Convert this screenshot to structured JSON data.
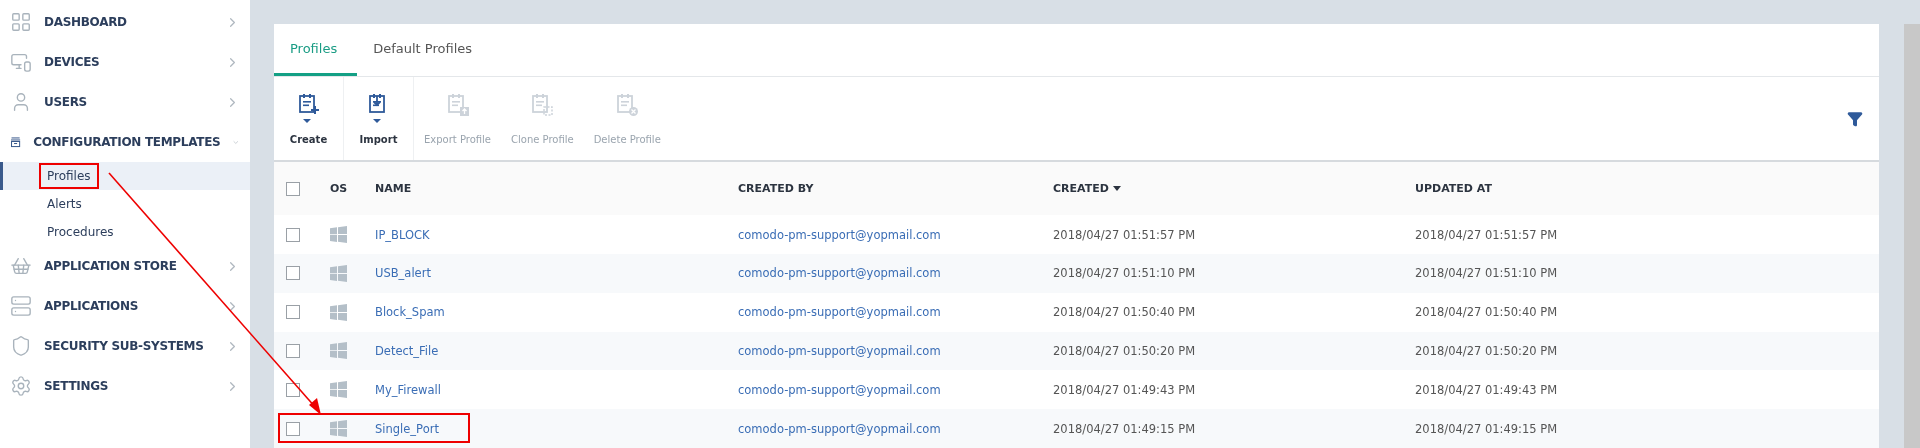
{
  "sidebar": {
    "items": [
      {
        "label": "DASHBOARD",
        "expanded": false
      },
      {
        "label": "DEVICES",
        "expanded": false
      },
      {
        "label": "USERS",
        "expanded": false
      },
      {
        "label": "CONFIGURATION TEMPLATES",
        "expanded": true,
        "children": [
          {
            "label": "Profiles",
            "selected": true,
            "highlighted": true
          },
          {
            "label": "Alerts",
            "selected": false,
            "highlighted": false
          },
          {
            "label": "Procedures",
            "selected": false,
            "highlighted": false
          }
        ]
      },
      {
        "label": "APPLICATION STORE",
        "expanded": false
      },
      {
        "label": "APPLICATIONS",
        "expanded": false
      },
      {
        "label": "SECURITY SUB-SYSTEMS",
        "expanded": false
      },
      {
        "label": "SETTINGS",
        "expanded": false
      }
    ]
  },
  "tabs": [
    {
      "label": "Profiles",
      "selected": true
    },
    {
      "label": "Default Profiles",
      "selected": false
    }
  ],
  "toolbar": [
    {
      "label": "Create",
      "disabled": false
    },
    {
      "label": "Import",
      "disabled": false
    },
    {
      "label": "Export Profile",
      "disabled": true
    },
    {
      "label": "Clone Profile",
      "disabled": true
    },
    {
      "label": "Delete Profile",
      "disabled": true
    }
  ],
  "table": {
    "all_checked": false,
    "columns": [
      {
        "label": "OS",
        "sorted": false
      },
      {
        "label": "NAME",
        "sorted": false
      },
      {
        "label": "CREATED BY",
        "sorted": false
      },
      {
        "label": "CREATED",
        "sorted": true
      },
      {
        "label": "UPDATED AT",
        "sorted": false
      }
    ],
    "rows": [
      {
        "name": "IP_BLOCK",
        "created_by": "comodo-pm-support@yopmail.com",
        "created": "2018/04/27 01:51:57 PM",
        "updated_at": "2018/04/27 01:51:57 PM",
        "checked": false,
        "highlighted": false
      },
      {
        "name": "USB_alert",
        "created_by": "comodo-pm-support@yopmail.com",
        "created": "2018/04/27 01:51:10 PM",
        "updated_at": "2018/04/27 01:51:10 PM",
        "checked": false,
        "highlighted": false
      },
      {
        "name": "Block_Spam",
        "created_by": "comodo-pm-support@yopmail.com",
        "created": "2018/04/27 01:50:40 PM",
        "updated_at": "2018/04/27 01:50:40 PM",
        "checked": false,
        "highlighted": false
      },
      {
        "name": "Detect_File",
        "created_by": "comodo-pm-support@yopmail.com",
        "created": "2018/04/27 01:50:20 PM",
        "updated_at": "2018/04/27 01:50:20 PM",
        "checked": false,
        "highlighted": false
      },
      {
        "name": "My_Firewall",
        "created_by": "comodo-pm-support@yopmail.com",
        "created": "2018/04/27 01:49:43 PM",
        "updated_at": "2018/04/27 01:49:43 PM",
        "checked": false,
        "highlighted": false
      },
      {
        "name": "Single_Port",
        "created_by": "comodo-pm-support@yopmail.com",
        "created": "2018/04/27 01:49:15 PM",
        "updated_at": "2018/04/27 01:49:15 PM",
        "checked": false,
        "highlighted": true
      }
    ]
  },
  "annotation_arrow": true
}
